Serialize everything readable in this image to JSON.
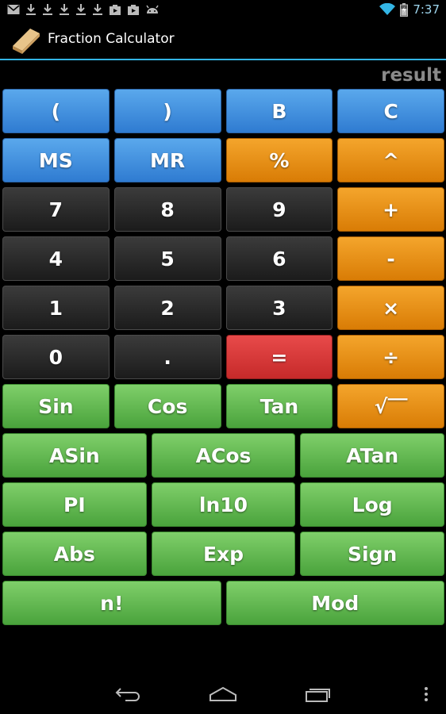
{
  "status_bar": {
    "time": "7:37",
    "left_icons": [
      "gmail-icon",
      "download-icon",
      "download-icon",
      "download-icon",
      "download-icon",
      "download-icon",
      "play-store-icon",
      "play-store-icon",
      "android-icon"
    ],
    "right_icons": [
      "wifi-icon",
      "battery-icon"
    ]
  },
  "action_bar": {
    "title": "Fraction Calculator",
    "icon": "eraser-icon"
  },
  "display": {
    "result": "result"
  },
  "keypad": {
    "rows": [
      [
        {
          "label": "(",
          "style": "blue",
          "name": "open-paren-button"
        },
        {
          "label": ")",
          "style": "blue",
          "name": "close-paren-button"
        },
        {
          "label": "B",
          "style": "blue",
          "name": "backspace-button"
        },
        {
          "label": "C",
          "style": "blue",
          "name": "clear-button"
        }
      ],
      [
        {
          "label": "MS",
          "style": "blue",
          "name": "memory-store-button"
        },
        {
          "label": "MR",
          "style": "blue",
          "name": "memory-recall-button"
        },
        {
          "label": "%",
          "style": "orange",
          "name": "percent-button"
        },
        {
          "label": "^",
          "style": "orange",
          "name": "power-button"
        }
      ],
      [
        {
          "label": "7",
          "style": "dark",
          "name": "digit-7-button"
        },
        {
          "label": "8",
          "style": "dark",
          "name": "digit-8-button"
        },
        {
          "label": "9",
          "style": "dark",
          "name": "digit-9-button"
        },
        {
          "label": "+",
          "style": "orange",
          "name": "add-button"
        }
      ],
      [
        {
          "label": "4",
          "style": "dark",
          "name": "digit-4-button"
        },
        {
          "label": "5",
          "style": "dark",
          "name": "digit-5-button"
        },
        {
          "label": "6",
          "style": "dark",
          "name": "digit-6-button"
        },
        {
          "label": "-",
          "style": "orange",
          "name": "subtract-button"
        }
      ],
      [
        {
          "label": "1",
          "style": "dark",
          "name": "digit-1-button"
        },
        {
          "label": "2",
          "style": "dark",
          "name": "digit-2-button"
        },
        {
          "label": "3",
          "style": "dark",
          "name": "digit-3-button"
        },
        {
          "label": "×",
          "style": "orange",
          "name": "multiply-button"
        }
      ],
      [
        {
          "label": "0",
          "style": "dark",
          "name": "digit-0-button"
        },
        {
          "label": ".",
          "style": "dark",
          "name": "decimal-button"
        },
        {
          "label": "=",
          "style": "red",
          "name": "equals-button"
        },
        {
          "label": "÷",
          "style": "orange",
          "name": "divide-button"
        }
      ],
      [
        {
          "label": "Sin",
          "style": "green",
          "name": "sin-button"
        },
        {
          "label": "Cos",
          "style": "green",
          "name": "cos-button"
        },
        {
          "label": "Tan",
          "style": "green",
          "name": "tan-button"
        },
        {
          "label": "√‾‾",
          "style": "orange",
          "name": "square-root-button"
        }
      ],
      [
        {
          "label": "ASin",
          "style": "green",
          "name": "asin-button"
        },
        {
          "label": "ACos",
          "style": "green",
          "name": "acos-button"
        },
        {
          "label": "ATan",
          "style": "green",
          "name": "atan-button"
        }
      ],
      [
        {
          "label": "PI",
          "style": "green",
          "name": "pi-button"
        },
        {
          "label": "ln10",
          "style": "green",
          "name": "ln10-button"
        },
        {
          "label": "Log",
          "style": "green",
          "name": "log-button"
        }
      ],
      [
        {
          "label": "Abs",
          "style": "green",
          "name": "abs-button"
        },
        {
          "label": "Exp",
          "style": "green",
          "name": "exp-button"
        },
        {
          "label": "Sign",
          "style": "green",
          "name": "sign-button"
        }
      ],
      [
        {
          "label": "n!",
          "style": "green",
          "name": "factorial-button"
        },
        {
          "label": "Mod",
          "style": "green",
          "name": "mod-button"
        }
      ]
    ]
  },
  "nav_bar": {
    "buttons": [
      "back-icon",
      "home-icon",
      "recent-apps-icon",
      "overflow-menu-icon"
    ]
  }
}
